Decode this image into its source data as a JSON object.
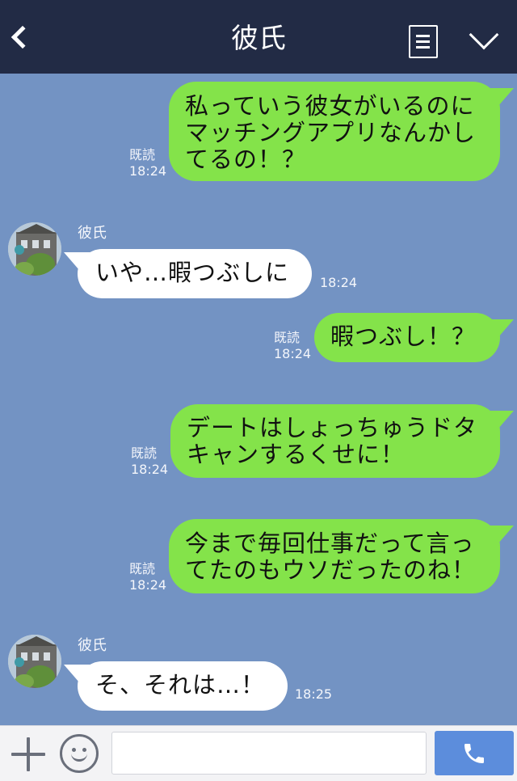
{
  "header": {
    "title": "彼氏",
    "back_icon": "back-chevron-icon",
    "menu_icon": "notes-icon",
    "dropdown_icon": "chevron-down-icon"
  },
  "colors": {
    "header_bg": "#222b45",
    "chat_bg": "#7393c3",
    "outgoing_bubble": "#84e34a",
    "incoming_bubble": "#ffffff",
    "call_button": "#5c8ddc"
  },
  "messages": [
    {
      "direction": "out",
      "text": "私っていう彼女がいるのに\nマッチングアプリなんかし\nてるの！？",
      "read_label": "既読",
      "time": "18:24"
    },
    {
      "direction": "in",
      "sender": "彼氏",
      "text": "いや…暇つぶしに",
      "time": "18:24"
    },
    {
      "direction": "out",
      "text": "暇つぶし！？",
      "read_label": "既読",
      "time": "18:24"
    },
    {
      "direction": "out",
      "text": "デートはしょっちゅうドタ\nキャンするくせに！",
      "read_label": "既読",
      "time": "18:24"
    },
    {
      "direction": "out",
      "text": "今まで毎回仕事だって言っ\nてたのもウソだったのね！",
      "read_label": "既読",
      "time": "18:24"
    },
    {
      "direction": "in",
      "sender": "彼氏",
      "text": "そ、それは…！",
      "time": "18:25"
    }
  ],
  "footer": {
    "plus_icon": "plus-icon",
    "emoji_icon": "smiley-icon",
    "input_value": "",
    "input_placeholder": "",
    "call_icon": "phone-icon"
  }
}
